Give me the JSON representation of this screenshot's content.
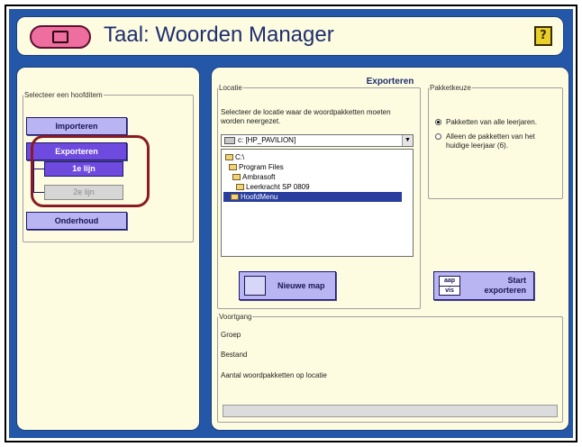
{
  "app": {
    "title": "Taal: Woorden Manager",
    "help_label": "?"
  },
  "sidebar": {
    "group_label": "Selecteer een hoofditem",
    "items": [
      {
        "label": "Importeren",
        "active": false
      },
      {
        "label": "Exporteren",
        "active": true
      },
      {
        "label": "Onderhoud",
        "active": false
      }
    ],
    "subitems": [
      {
        "label": "1e lijn",
        "state": "active"
      },
      {
        "label": "2e lijn",
        "state": "disabled"
      }
    ]
  },
  "main": {
    "section_title": "Exporteren",
    "locatie": {
      "group_label": "Locatie",
      "instruction": "Selecteer de locatie waar de woordpakketten moeten worden neergezet.",
      "drive": "c: [HP_PAVILION]",
      "folders": [
        {
          "label": "C:\\",
          "indent": 0,
          "selected": false
        },
        {
          "label": "Program Files",
          "indent": 1,
          "selected": false
        },
        {
          "label": "Ambrasoft",
          "indent": 2,
          "selected": false
        },
        {
          "label": "Leerkracht SP 0809",
          "indent": 3,
          "selected": false
        },
        {
          "label": "HoofdMenu",
          "indent": 4,
          "selected": true
        }
      ],
      "new_folder_label": "Nieuwe map"
    },
    "pakketkeuze": {
      "group_label": "Pakketkeuze",
      "options": [
        {
          "label": "Pakketten van alle leerjaren.",
          "checked": true
        },
        {
          "label": "Alleen de pakketten van het huidige leerjaar (6).",
          "checked": false
        }
      ],
      "start_icon_text_1": "aap",
      "start_icon_text_2": "vis",
      "start_label_1": "Start",
      "start_label_2": "exporteren"
    },
    "voortgang": {
      "group_label": "Voortgang",
      "groep_label": "Groep",
      "bestand_label": "Bestand",
      "aantal_label": "Aantal woordpakketten op locatie"
    }
  },
  "colors": {
    "background_blue": "#2457a8",
    "panel_cream": "#fdfce0",
    "button_lavender": "#b9b4f2",
    "button_active": "#6f4adf",
    "highlight_red": "#8a1b24"
  }
}
